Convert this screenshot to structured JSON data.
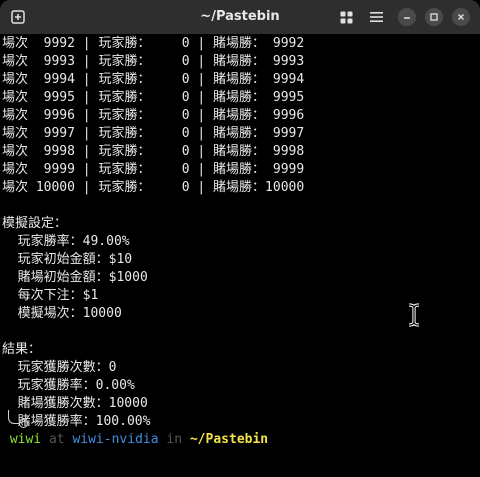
{
  "window": {
    "title": "~/Pastebin"
  },
  "titlebar_icons": [
    "new-tab-icon",
    "split-view-icon",
    "hamburger-menu-icon",
    "minimize-icon",
    "maximize-icon",
    "close-icon"
  ],
  "terminal": {
    "rounds": [
      "場次  9992 | 玩家勝：    0 | 賭場勝： 9992",
      "場次  9993 | 玩家勝：    0 | 賭場勝： 9993",
      "場次  9994 | 玩家勝：    0 | 賭場勝： 9994",
      "場次  9995 | 玩家勝：    0 | 賭場勝： 9995",
      "場次  9996 | 玩家勝：    0 | 賭場勝： 9996",
      "場次  9997 | 玩家勝：    0 | 賭場勝： 9997",
      "場次  9998 | 玩家勝：    0 | 賭場勝： 9998",
      "場次  9999 | 玩家勝：    0 | 賭場勝： 9999",
      "場次 10000 | 玩家勝：    0 | 賭場勝：10000"
    ],
    "settings_header": "模擬設定：",
    "settings": [
      "  玩家勝率：49.00%",
      "  玩家初始金額：$10",
      "  賭場初始金額：$1000",
      "  每次下注：$1",
      "  模擬場次：10000"
    ],
    "results_header": "結果：",
    "results": [
      "  玩家獲勝次數：0",
      "  玩家獲勝率：0.00%",
      "  賭場獲勝次數：10000",
      "  賭場獲勝率：100.00%"
    ],
    "prompt": {
      "user": "wiwi",
      "at": "at",
      "host": "wiwi-nvidia",
      "in": "in",
      "path": "~/Pastebin"
    }
  },
  "colors": {
    "background": "#000000",
    "text": "#e9e9e9",
    "user": "#8ae234",
    "host": "#3f8fe0",
    "path": "#f2e44a"
  }
}
